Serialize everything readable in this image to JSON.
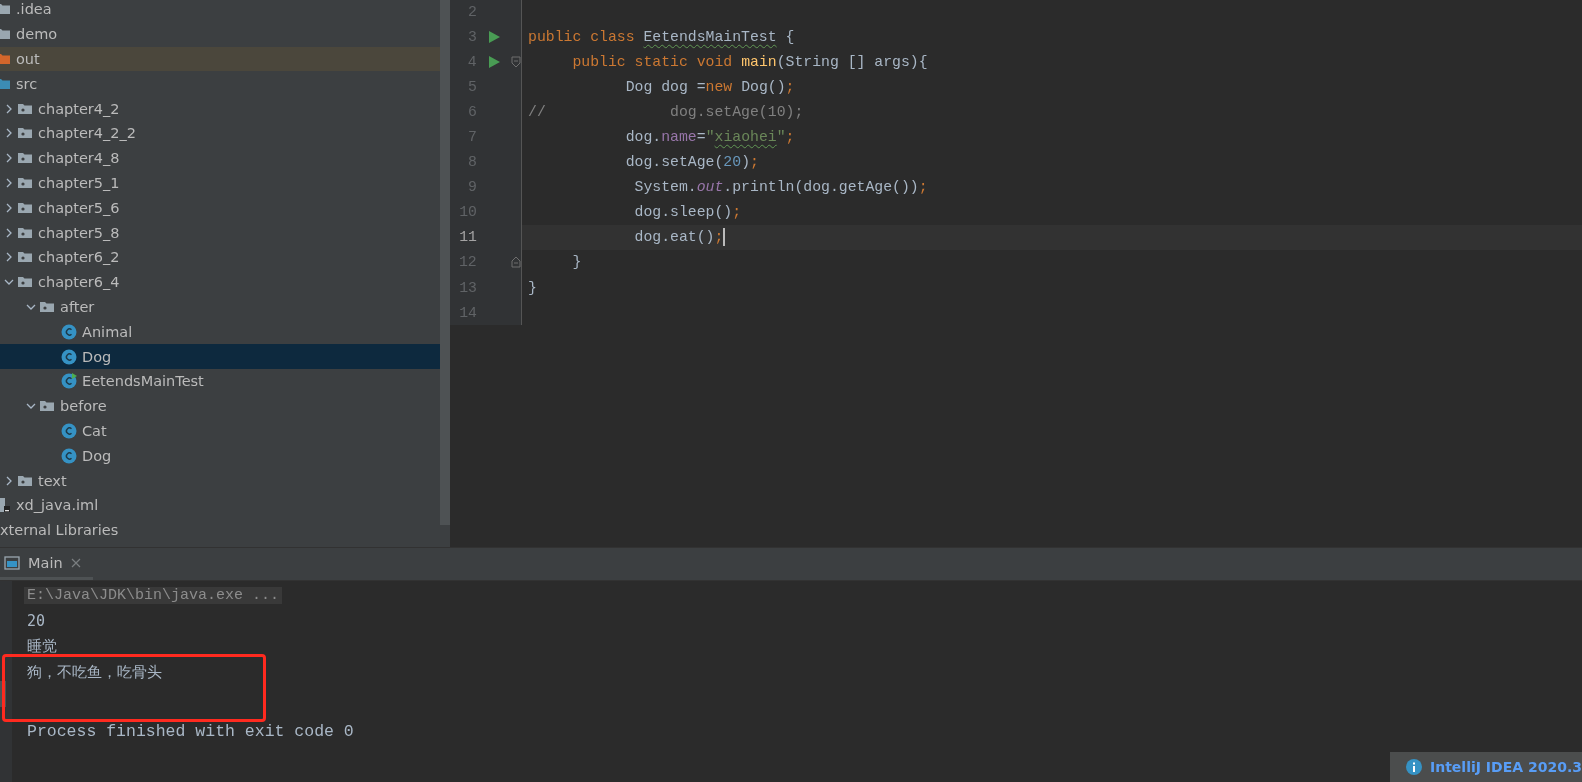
{
  "project_tree": [
    {
      "label": ".idea",
      "kind": "folder",
      "selected": false
    },
    {
      "label": "demo",
      "kind": "folder",
      "selected": false
    },
    {
      "label": "out",
      "kind": "excluded-folder",
      "selected": false
    },
    {
      "label": "src",
      "kind": "source-folder",
      "selected": false,
      "children": [
        {
          "label": "chapter4_2",
          "kind": "package",
          "expanded": false,
          "selected": false
        },
        {
          "label": "chapter4_2_2",
          "kind": "package",
          "expanded": false,
          "selected": false
        },
        {
          "label": "chapter4_8",
          "kind": "package",
          "expanded": false,
          "selected": false
        },
        {
          "label": "chapter5_1",
          "kind": "package",
          "expanded": false,
          "selected": false
        },
        {
          "label": "chapter5_6",
          "kind": "package",
          "expanded": false,
          "selected": false
        },
        {
          "label": "chapter5_8",
          "kind": "package",
          "expanded": false,
          "selected": false
        },
        {
          "label": "chapter6_2",
          "kind": "package",
          "expanded": false,
          "selected": false
        },
        {
          "label": "chapter6_4",
          "kind": "package",
          "expanded": true,
          "selected": false,
          "children": [
            {
              "label": "after",
              "kind": "package",
              "expanded": true,
              "selected": false,
              "children": [
                {
                  "label": "Animal",
                  "kind": "class",
                  "selected": false
                },
                {
                  "label": "Dog",
                  "kind": "class",
                  "selected": true
                },
                {
                  "label": "EetendsMainTest",
                  "kind": "runnable-class",
                  "selected": false
                }
              ]
            },
            {
              "label": "before",
              "kind": "package",
              "expanded": true,
              "selected": false,
              "children": [
                {
                  "label": "Cat",
                  "kind": "class",
                  "selected": false
                },
                {
                  "label": "Dog",
                  "kind": "class",
                  "selected": false
                }
              ]
            }
          ]
        },
        {
          "label": "text",
          "kind": "package",
          "expanded": false,
          "selected": false
        }
      ]
    },
    {
      "label": "xd_java.iml",
      "kind": "module-file",
      "selected": false
    },
    {
      "label": "xternal Libraries",
      "kind": "library",
      "selected": false
    }
  ],
  "editor": {
    "lines": [
      {
        "number": "2",
        "run": false,
        "fold_open": false,
        "fold_close": false,
        "current": false
      },
      {
        "number": "3",
        "run": true,
        "fold_open": false,
        "fold_close": false,
        "current": false,
        "tokens": [
          {
            "kind": "keyword",
            "text": "public class "
          },
          {
            "kind": "plain",
            "text": "EetendsMainTest",
            "typo": true
          },
          {
            "kind": "plain",
            "text": " {"
          }
        ]
      },
      {
        "number": "4",
        "run": true,
        "fold_open": true,
        "fold_close": false,
        "current": false,
        "tokens": [
          {
            "kind": "keyword",
            "text": "     public static void "
          },
          {
            "kind": "method",
            "text": "main"
          },
          {
            "kind": "plain",
            "text": "(String [] args){"
          }
        ]
      },
      {
        "number": "5",
        "run": false,
        "fold_open": false,
        "fold_close": false,
        "current": false,
        "tokens": [
          {
            "kind": "plain",
            "text": "           Dog dog ="
          },
          {
            "kind": "keyword",
            "text": "new "
          },
          {
            "kind": "plain",
            "text": "Dog()"
          },
          {
            "kind": "keyword",
            "text": ";"
          }
        ]
      },
      {
        "number": "6",
        "run": false,
        "fold_open": false,
        "fold_close": false,
        "current": false,
        "tokens": [
          {
            "kind": "comment",
            "text": "//              dog.setAge(10);"
          }
        ]
      },
      {
        "number": "7",
        "run": false,
        "fold_open": false,
        "fold_close": false,
        "current": false,
        "tokens": [
          {
            "kind": "plain",
            "text": "           dog."
          },
          {
            "kind": "field",
            "text": "name"
          },
          {
            "kind": "plain",
            "text": "="
          },
          {
            "kind": "string",
            "text": "\""
          },
          {
            "kind": "string",
            "text": "xiaohei",
            "typo": true
          },
          {
            "kind": "string",
            "text": "\""
          },
          {
            "kind": "keyword",
            "text": ";"
          }
        ]
      },
      {
        "number": "8",
        "run": false,
        "fold_open": false,
        "fold_close": false,
        "current": false,
        "tokens": [
          {
            "kind": "plain",
            "text": "           dog.setAge("
          },
          {
            "kind": "number",
            "text": "20"
          },
          {
            "kind": "plain",
            "text": ")"
          },
          {
            "kind": "keyword",
            "text": ";"
          }
        ]
      },
      {
        "number": "9",
        "run": false,
        "fold_open": false,
        "fold_close": false,
        "current": false,
        "tokens": [
          {
            "kind": "plain",
            "text": "            System."
          },
          {
            "kind": "static",
            "text": "out"
          },
          {
            "kind": "plain",
            "text": ".println(dog.getAge())"
          },
          {
            "kind": "keyword",
            "text": ";"
          }
        ]
      },
      {
        "number": "10",
        "run": false,
        "fold_open": false,
        "fold_close": false,
        "current": false,
        "tokens": [
          {
            "kind": "plain",
            "text": "            dog.sleep()"
          },
          {
            "kind": "keyword",
            "text": ";"
          }
        ]
      },
      {
        "number": "11",
        "run": false,
        "fold_open": false,
        "fold_close": false,
        "current": true,
        "tokens": [
          {
            "kind": "plain",
            "text": "            dog.eat()"
          },
          {
            "kind": "keyword",
            "text": ";"
          }
        ]
      },
      {
        "number": "12",
        "run": false,
        "fold_open": false,
        "fold_close": true,
        "current": false,
        "tokens": [
          {
            "kind": "plain",
            "text": "     }"
          }
        ]
      },
      {
        "number": "13",
        "run": false,
        "fold_open": false,
        "fold_close": false,
        "current": false,
        "tokens": [
          {
            "kind": "plain",
            "text": "}"
          }
        ]
      },
      {
        "number": "14",
        "run": false,
        "fold_open": false,
        "fold_close": false,
        "current": false
      }
    ]
  },
  "run_panel": {
    "tab": {
      "label": "Main",
      "selected": true
    },
    "console": [
      {
        "kind": "command",
        "text": "E:\\Java\\JDK\\bin\\java.exe ...",
        "highlighted": false
      },
      {
        "kind": "output",
        "text": "20",
        "highlighted": false
      },
      {
        "kind": "output",
        "text": "睡觉",
        "highlighted": false
      },
      {
        "kind": "output",
        "text": "狗，不吃鱼，吃骨头",
        "highlighted": true
      },
      {
        "kind": "blank"
      },
      {
        "kind": "exit",
        "text": "Process finished with exit code 0",
        "highlighted": false
      }
    ]
  },
  "notification": {
    "title": "IntelliJ IDEA 2020.3"
  }
}
